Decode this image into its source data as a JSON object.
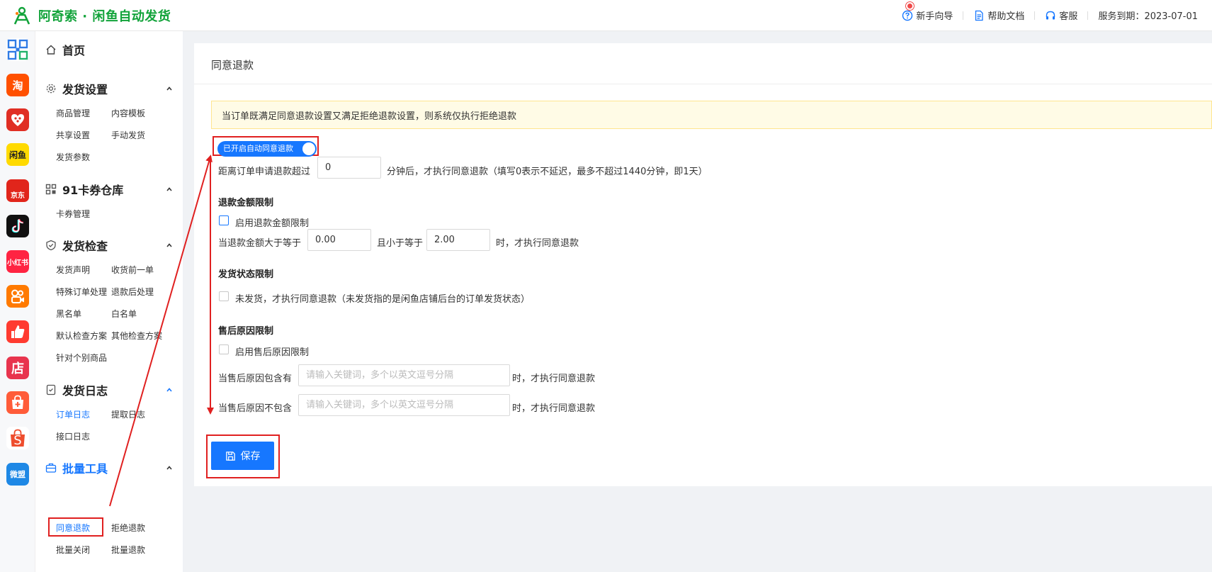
{
  "header": {
    "title": "阿奇索 · 闲鱼自动发货",
    "links": [
      {
        "label": "新手向导",
        "icon": "help-circle-icon"
      },
      {
        "label": "帮助文档",
        "icon": "document-icon"
      },
      {
        "label": "客服",
        "icon": "headset-icon"
      }
    ],
    "service": "服务到期：2023-07-01"
  },
  "rail": {
    "apps": [
      {
        "icon": "grid-app-icon",
        "text": "",
        "color": "#2f7be5"
      },
      {
        "icon": "taobao-icon",
        "text": "淘",
        "color": "#ff5000"
      },
      {
        "icon": "pinduoduo-icon",
        "text": "",
        "color": "#e02e24"
      },
      {
        "icon": "xianyu-icon",
        "text": "闲鱼",
        "color": "#ffda00"
      },
      {
        "icon": "jd-icon",
        "text": "京东",
        "color": "#e1251b"
      },
      {
        "icon": "douyin-icon",
        "text": "",
        "color": "#111111"
      },
      {
        "icon": "xiaohongshu-icon",
        "text": "小红书",
        "color": "#ff2442"
      },
      {
        "icon": "kuaishou-icon",
        "text": "",
        "color": "#ff7a00"
      },
      {
        "icon": "thumbs-up-icon",
        "text": "",
        "color": "#ff3b30"
      },
      {
        "icon": "store-icon",
        "text": "店",
        "color": "#e8344e"
      },
      {
        "icon": "shopping-bag-icon",
        "text": "",
        "color": "#ff5c39"
      },
      {
        "icon": "shopee-icon",
        "text": "S",
        "color": "#ee4d2d"
      },
      {
        "icon": "weimeng-icon",
        "text": "微盟",
        "color": "#1e88e5"
      }
    ]
  },
  "nav": {
    "home": "首页",
    "groups": [
      {
        "label": "发货设置",
        "items": [
          "商品管理",
          "内容模板",
          "共享设置",
          "手动发货",
          "发货参数"
        ]
      },
      {
        "label": "91卡券仓库",
        "items": [
          "卡券管理"
        ]
      },
      {
        "label": "发货检查",
        "items": [
          "发货声明",
          "收货前一单",
          "特殊订单处理",
          "退款后处理",
          "黑名单",
          "白名单",
          "默认检查方案",
          "其他检查方案",
          "针对个别商品"
        ]
      },
      {
        "label": "发货日志",
        "items": [
          "订单日志",
          "提取日志",
          "接口日志"
        ]
      },
      {
        "label": "批量工具",
        "items": [
          "同意退款",
          "拒绝退款",
          "批量关闭",
          "批量退款"
        ]
      }
    ]
  },
  "main": {
    "title": "同意退款",
    "notice": "当订单既满足同意退款设置又满足拒绝退款设置，则系统仅执行拒绝退款",
    "switch_label": "已开启自动同意退款",
    "delay": {
      "prefix": "距离订单申请退款超过",
      "value": "0",
      "suffix": "分钟后，才执行同意退款（填写0表示不延迟，最多不超过1440分钟，即1天）"
    },
    "amount": {
      "title": "退款金额限制",
      "checkbox_label": "启用退款金额限制",
      "prefix": "当退款金额大于等于",
      "min": "0.00",
      "middle": "且小于等于",
      "max": "2.00",
      "suffix": "时，才执行同意退款"
    },
    "ship": {
      "title": "发货状态限制",
      "checkbox_label": "未发货，才执行同意退款（未发货指的是闲鱼店铺后台的订单发货状态）"
    },
    "reason": {
      "title": "售后原因限制",
      "checkbox_label": "启用售后原因限制",
      "include_label": "当售后原因包含有",
      "include_placeholder": "请输入关键词，多个以英文逗号分隔",
      "include_suffix": "时，才执行同意退款",
      "exclude_label": "当售后原因不包含",
      "exclude_placeholder": "请输入关键词，多个以英文逗号分隔",
      "exclude_suffix": "时，才执行同意退款"
    },
    "save_label": "保存"
  },
  "colors": {
    "brand_green": "#12a33a",
    "primary": "#1677ff",
    "annotation_red": "#e02020"
  }
}
